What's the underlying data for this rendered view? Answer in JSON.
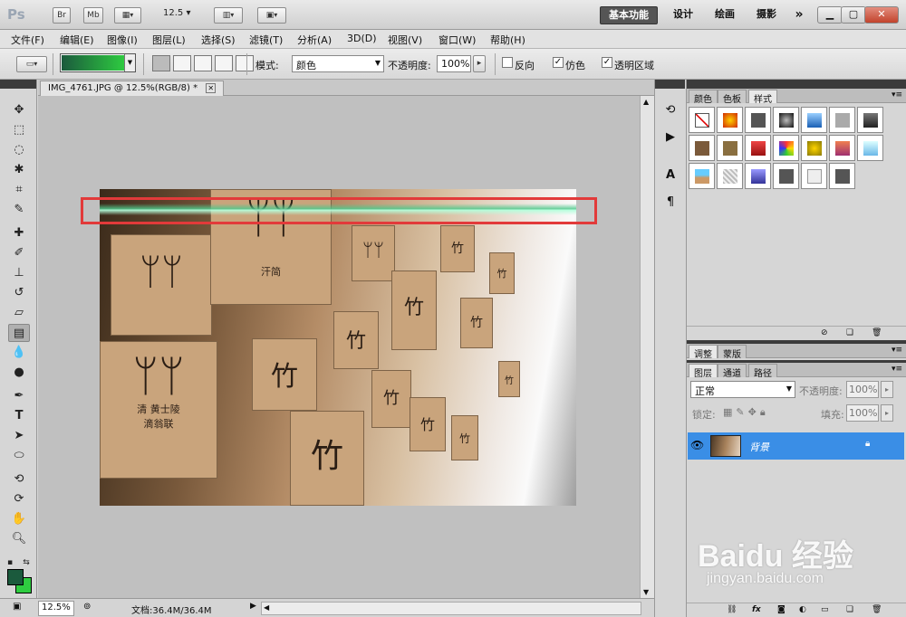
{
  "app": {
    "logo": "Ps",
    "bridge_btn": "Br",
    "minibridge_btn": "Mb",
    "zoom_select": "12.5",
    "workspaces": [
      "基本功能",
      "设计",
      "绘画",
      "摄影"
    ],
    "more": "»",
    "win_min": "▁",
    "win_max": "▢",
    "win_close": "✕"
  },
  "menu": [
    "文件(F)",
    "编辑(E)",
    "图像(I)",
    "图层(L)",
    "选择(S)",
    "滤镜(T)",
    "分析(A)",
    "3D(D)",
    "视图(V)",
    "窗口(W)",
    "帮助(H)"
  ],
  "options": {
    "mode_label": "模式:",
    "mode_value": "颜色",
    "opacity_label": "不透明度:",
    "opacity_value": "100%",
    "reverse_label": "反向",
    "dither_label": "仿色",
    "transparency_label": "透明区域",
    "reverse_checked": false,
    "dither_checked": true,
    "transparency_checked": true,
    "gradient_from": "#1b5a3d",
    "gradient_to": "#2ecc40"
  },
  "document": {
    "tab_title": "IMG_4761.JPG @ 12.5%(RGB/8) *",
    "zoom_status": "12.5%",
    "doc_info": "文档:36.4M/36.4M"
  },
  "tools": [
    "move-tool",
    "marquee-tool",
    "lasso-tool",
    "quick-select-tool",
    "crop-tool",
    "eyedropper-tool",
    "healing-brush-tool",
    "brush-tool",
    "clone-stamp-tool",
    "history-brush-tool",
    "eraser-tool",
    "gradient-tool",
    "blur-tool",
    "dodge-tool",
    "pen-tool",
    "type-tool",
    "path-select-tool",
    "shape-tool",
    "3d-rotate-tool",
    "3d-orbit-tool",
    "hand-tool",
    "zoom-tool"
  ],
  "colors": {
    "foreground": "#1b5a3d",
    "background": "#2ecc40",
    "selection_box": "#e23a3a"
  },
  "styles_panel": {
    "tabs": [
      "颜色",
      "色板",
      "样式"
    ],
    "active_tab": "样式"
  },
  "adjust_panel": {
    "tabs": [
      "调整",
      "蒙版"
    ]
  },
  "layers_panel": {
    "tabs": [
      "图层",
      "通道",
      "路径"
    ],
    "blend_mode": "正常",
    "opacity_label": "不透明度:",
    "opacity_value": "100%",
    "lock_label": "锁定:",
    "fill_label": "填充:",
    "fill_value": "100%",
    "layers": [
      {
        "name": "背景",
        "visible": true,
        "locked": true,
        "selected": true
      }
    ]
  },
  "photo_text": {
    "label_1": "汗简",
    "label_2": "清  黄士陵",
    "label_3": "滴翁联"
  },
  "watermark": {
    "main": "Baidu 经验",
    "sub": "jingyan.baidu.com"
  }
}
